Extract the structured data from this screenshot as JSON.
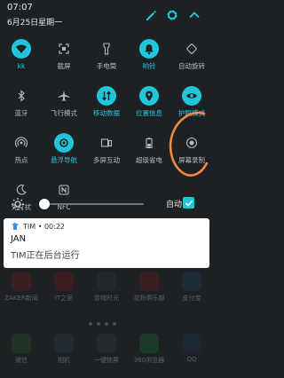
{
  "status": {
    "time": "07:07",
    "date": "6月25日星期一"
  },
  "header_icons": [
    "pencil-icon",
    "gear-icon",
    "chevron-up-icon"
  ],
  "tiles": [
    {
      "label": "kk",
      "icon": "wifi-icon",
      "on": true
    },
    {
      "label": "截屏",
      "icon": "screenshot-icon",
      "on": false
    },
    {
      "label": "手电筒",
      "icon": "flashlight-icon",
      "on": false
    },
    {
      "label": "响铃",
      "icon": "bell-icon",
      "on": true
    },
    {
      "label": "自动旋转",
      "icon": "rotate-icon",
      "on": false
    },
    {
      "label": "蓝牙",
      "icon": "bluetooth-icon",
      "on": false
    },
    {
      "label": "飞行模式",
      "icon": "airplane-icon",
      "on": false
    },
    {
      "label": "移动数据",
      "icon": "mobile-data-icon",
      "on": true
    },
    {
      "label": "位置信息",
      "icon": "location-icon",
      "on": true
    },
    {
      "label": "护眼模式",
      "icon": "eye-icon",
      "on": true
    },
    {
      "label": "热点",
      "icon": "hotspot-icon",
      "on": false
    },
    {
      "label": "悬浮导航",
      "icon": "floating-nav-icon",
      "on": true
    },
    {
      "label": "多屏互动",
      "icon": "multiscreen-icon",
      "on": false
    },
    {
      "label": "超级省电",
      "icon": "battery-saver-icon",
      "on": false
    },
    {
      "label": "屏幕录制",
      "icon": "screen-record-icon",
      "on": false
    },
    {
      "label": "免打扰",
      "icon": "dnd-icon",
      "on": false
    },
    {
      "label": "NFC",
      "icon": "nfc-icon",
      "on": false
    }
  ],
  "brightness": {
    "level": 0.05,
    "auto_label": "自动",
    "auto_checked": true
  },
  "notification": {
    "app": "TIM",
    "time": "00:22",
    "title": "JAN",
    "body": "TIM正在后台运行"
  },
  "home_apps_row1": [
    "ZAKER新闻",
    "IT之家",
    "游戏时光",
    "花粉俱乐部",
    "支付宝"
  ],
  "home_apps_row2": [
    "微信",
    "相机",
    "一键锁屏",
    "360浏览器",
    "QQ"
  ],
  "colors": {
    "accent": "#20c5d9",
    "panel": "#1e2124",
    "annotation": "#f0883e"
  }
}
